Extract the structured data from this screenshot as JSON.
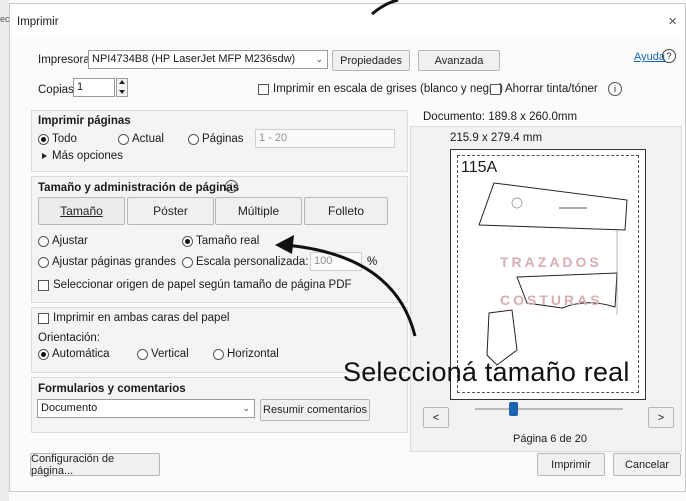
{
  "external": {
    "left_fragment": "ect"
  },
  "dialog": {
    "title": "Imprimir",
    "close": "×"
  },
  "printer": {
    "label": "Impresora:",
    "value": "NPI4734B8 (HP LaserJet MFP M236sdw)",
    "properties": "Propiedades",
    "advanced": "Avanzada",
    "help": "Ayuda",
    "help_icon": "?"
  },
  "copies": {
    "label": "Copias:",
    "value": "1",
    "grayscale": "Imprimir en escala de grises (blanco y negro)",
    "save_ink": "Ahorrar tinta/tóner",
    "info_icon": "i"
  },
  "pages": {
    "title": "Imprimir páginas",
    "all": "Todo",
    "current": "Actual",
    "pages": "Páginas",
    "range_placeholder": "1 - 20",
    "more": "Más opciones"
  },
  "sizing": {
    "title": "Tamaño y administración de páginas",
    "info_icon": "i",
    "tabs": [
      "Tamaño",
      "Póster",
      "Múltiple",
      "Folleto"
    ],
    "fit": "Ajustar",
    "actual": "Tamaño real",
    "shrink": "Ajustar páginas grandes",
    "custom": "Escala personalizada:",
    "custom_value": "100",
    "percent": "%",
    "source": "Seleccionar origen de papel según tamaño de página PDF"
  },
  "duplex": {
    "both_sides": "Imprimir en ambas caras del papel",
    "orientation_label": "Orientación:",
    "auto": "Automática",
    "vertical": "Vertical",
    "horizontal": "Horizontal"
  },
  "forms": {
    "title": "Formularios y comentarios",
    "value": "Documento",
    "summarize": "Resumir comentarios"
  },
  "preview": {
    "document": "Documento: 189.8 x 260.0mm",
    "paper": "215.9 x 279.4 mm",
    "page_code": "115A",
    "watermark1": "TRAZADOS",
    "watermark2": "COSTURAS",
    "prev": "<",
    "next": ">",
    "page_indicator": "Página 6 de 20",
    "slider_position": 0.26
  },
  "footer": {
    "page_setup": "Configuración de página...",
    "print": "Imprimir",
    "cancel": "Cancelar"
  },
  "annotation": {
    "text": "Seleccioná tamaño real"
  }
}
